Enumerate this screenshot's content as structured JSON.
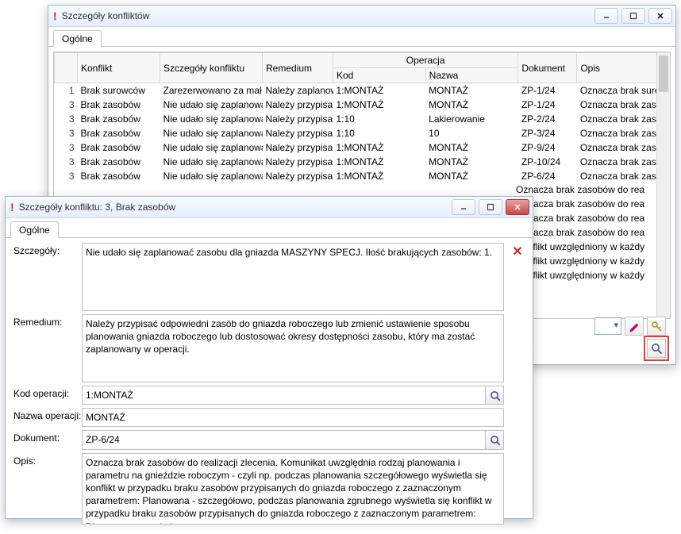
{
  "back_window": {
    "title": "Szczegóły konfliktów",
    "tab_label": "Ogólne",
    "columns": {
      "konflikt": "Konflikt",
      "szczegoly": "Szczegóły konfliktu",
      "remedium": "Remedium",
      "operacja": "Operacja",
      "kod": "Kod",
      "nazwa": "Nazwa",
      "dokument": "Dokument",
      "opis": "Opis"
    },
    "rows": [
      {
        "idx": "1",
        "konf": "Brak surowców",
        "szcz": "Zarezerwowano za mał",
        "rem": "Należy zaplanow",
        "kod": "1:MONTAŻ",
        "nazwa": "MONTAŻ",
        "dok": "ZP-1/24",
        "opis": "Oznacza brak surowców we w"
      },
      {
        "idx": "3",
        "konf": "Brak zasobów",
        "szcz": "Nie udało się zaplanowa",
        "rem": "Należy przypisa",
        "kod": "1:MONTAŻ",
        "nazwa": "MONTAŻ",
        "dok": "ZP-1/24",
        "opis": "Oznacza brak zasobów do rea"
      },
      {
        "idx": "3",
        "konf": "Brak zasobów",
        "szcz": "Nie udało się zaplanowa",
        "rem": "Należy przypisa",
        "kod": "1:10",
        "nazwa": "Lakierowanie",
        "dok": "ZP-2/24",
        "opis": "Oznacza brak zasobów do rea"
      },
      {
        "idx": "3",
        "konf": "Brak zasobów",
        "szcz": "Nie udało się zaplanowa",
        "rem": "Należy przypisa",
        "kod": "1:10",
        "nazwa": "10",
        "dok": "ZP-3/24",
        "opis": "Oznacza brak zasobów do rea"
      },
      {
        "idx": "3",
        "konf": "Brak zasobów",
        "szcz": "Nie udało się zaplanowa",
        "rem": "Należy przypisa",
        "kod": "1:MONTAŻ",
        "nazwa": "MONTAŻ",
        "dok": "ZP-9/24",
        "opis": "Oznacza brak zasobów do rea"
      },
      {
        "idx": "3",
        "konf": "Brak zasobów",
        "szcz": "Nie udało się zaplanowa",
        "rem": "Należy przypisa",
        "kod": "1:MONTAŻ",
        "nazwa": "MONTAŻ",
        "dok": "ZP-10/24",
        "opis": "Oznacza brak zasobów do rea"
      },
      {
        "idx": "3",
        "konf": "Brak zasobów",
        "szcz": "Nie udało się zaplanowa",
        "rem": "Należy przypisa",
        "kod": "1:MONTAŻ",
        "nazwa": "MONTAŻ",
        "dok": "ZP-6/24",
        "opis": "Oznacza brak zasobów do rea"
      }
    ],
    "overflow_opis": [
      "Oznacza brak zasobów do rea",
      "Oznacza brak zasobów do rea",
      "Oznacza brak zasobów do rea",
      "Oznacza brak zasobów do rea",
      "Konflikt uwzględniony w każdy",
      "Konflikt uwzględniony w każdy",
      "Konflikt uwzględniony w każdy"
    ]
  },
  "front_window": {
    "title": "Szczegóły konfliktu: 3, Brak zasobów",
    "tab_label": "Ogólne",
    "labels": {
      "szczegoly": "Szczegóły:",
      "remedium": "Remedium:",
      "kod": "Kod operacji:",
      "nazwa": "Nazwa operacji:",
      "dokument": "Dokument:",
      "opis": "Opis:"
    },
    "values": {
      "szczegoly": "Nie udało się zaplanować zasobu dla gniazda MASZYNY SPECJ. Ilość brakujących zasobów: 1.",
      "remedium": "Należy przypisać odpowiedni zasób do gniazda roboczego lub zmienić ustawienie sposobu planowania gniazda roboczego lub dostosować okresy dostępności zasobu, który ma zostać zaplanowany w operacji.",
      "kod": "1:MONTAŻ",
      "nazwa": "MONTAŻ",
      "dokument": "ZP-6/24",
      "opis": "Oznacza brak zasobów do realizacji zlecenia. Komunikat uwzględnia rodzaj planowania i parametru na gnieździe roboczym - czyli np. podczas planowania szczegółowego wyświetla się konflikt w przypadku braku zasobów przypisanych do gniazda roboczego z zaznaczonym parametrem: Planowana - szczegółowo, podczas planowania zgrubnego wyświetla się konflikt w przypadku braku zasobów przypisanych do gniazda roboczego z zaznaczonym parametrem: Planowana - zgrubnie."
    }
  }
}
